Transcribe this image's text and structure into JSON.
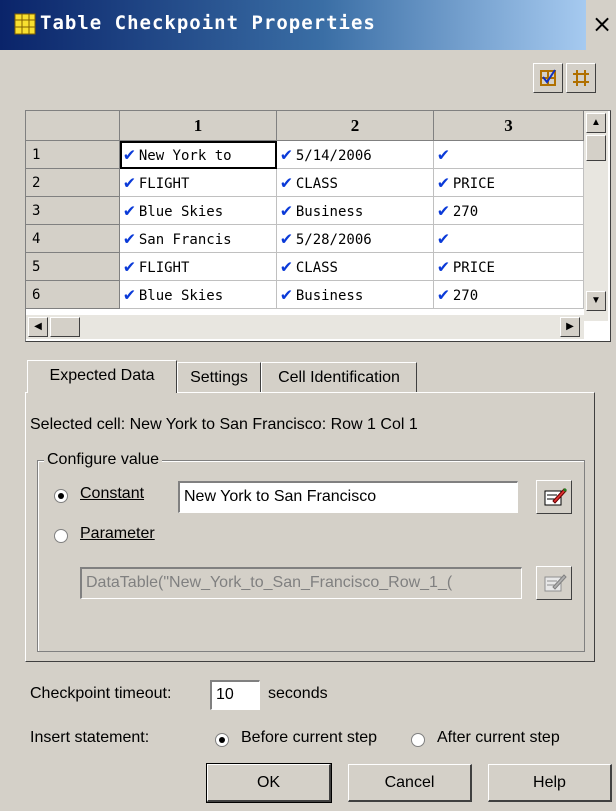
{
  "window": {
    "title": "Table Checkpoint Properties",
    "close_glyph": "×"
  },
  "toolbar": {
    "check_icon": "check-cells-icon",
    "grid_icon": "grid-icon"
  },
  "grid": {
    "columns": [
      "1",
      "2",
      "3"
    ],
    "rows": [
      {
        "num": "1",
        "cells": [
          "New York to",
          "5/14/2006",
          ""
        ]
      },
      {
        "num": "2",
        "cells": [
          "FLIGHT",
          "CLASS",
          "PRICE"
        ]
      },
      {
        "num": "3",
        "cells": [
          "Blue Skies",
          "Business",
          "270"
        ]
      },
      {
        "num": "4",
        "cells": [
          "San Francis",
          "5/28/2006",
          ""
        ]
      },
      {
        "num": "5",
        "cells": [
          "FLIGHT",
          "CLASS",
          "PRICE"
        ]
      },
      {
        "num": "6",
        "cells": [
          "Blue Skies",
          "Business",
          "270"
        ]
      }
    ],
    "check": "✔"
  },
  "tabs": [
    "Expected Data",
    "Settings",
    "Cell Identification"
  ],
  "selected_cell": "Selected cell: New York to San Francisco: Row 1 Col 1",
  "configure": {
    "group_label": "Configure value",
    "constant_label": "Constant",
    "constant_value": "New York to San Francisco",
    "parameter_label": "Parameter",
    "parameter_value": "DataTable(\"New_York_to_San_Francisco_Row_1_("
  },
  "timeout": {
    "label": "Checkpoint timeout:",
    "value": "10",
    "unit": "seconds"
  },
  "insert": {
    "label": "Insert statement:",
    "before": "Before current step",
    "after": "After current step"
  },
  "buttons": {
    "ok": "OK",
    "cancel": "Cancel",
    "help": "Help"
  }
}
